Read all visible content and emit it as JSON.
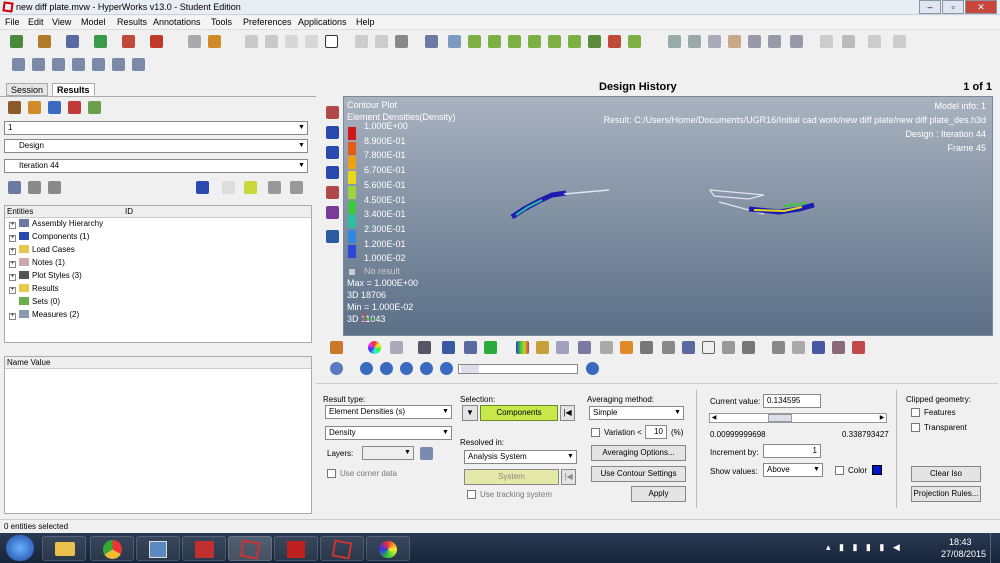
{
  "window": {
    "title": "new diff plate.mvw - HyperWorks v13.0 - Student Edition"
  },
  "menu": [
    "File",
    "Edit",
    "View",
    "Model",
    "Results",
    "Annotations",
    "Tools",
    "Preferences",
    "Applications",
    "Help"
  ],
  "left_panel": {
    "tabs": [
      "Session",
      "Results"
    ],
    "active_tab": "Results",
    "dropdown1": "1",
    "dropdown2": "Design",
    "dropdown3": "Iteration 44",
    "entities_header": "Entities",
    "entities_cols": "ID",
    "tree": [
      "Assembly Hierarchy",
      "Components (1)",
      "Load Cases",
      "Notes (1)",
      "Plot Styles (3)",
      "Results",
      "Sets  (0)",
      "Measures (2)"
    ],
    "props_header": "Name Value"
  },
  "page": {
    "title": "Design History",
    "page_count": "1 of 1"
  },
  "viewport": {
    "plot_title": "Contour Plot",
    "plot_sub": "Element Densities(Density)",
    "legend_values": [
      "1.000E+00",
      "8.900E-01",
      "7.800E-01",
      "6.700E-01",
      "5.600E-01",
      "4.500E-01",
      "3.400E-01",
      "2.300E-01",
      "1.200E-01",
      "1.000E-02"
    ],
    "legend_colors": [
      "#d0181c",
      "#e65c14",
      "#f0a014",
      "#e8d81c",
      "#9cd43c",
      "#3cc83c",
      "#2cc0a0",
      "#2c88e0",
      "#2c48d8",
      "#1c1cb0"
    ],
    "no_result": "No result",
    "max_text": "Max = 1.000E+00",
    "max_loc": "3D 18706",
    "min_text": "Min = 1.000E-02",
    "min_loc": "3D 11043",
    "model_info": "Model info: 1",
    "result_path": "Result: C:/Users/Home/Documents/UGR16/Initial cad work/new diff plate/new diff plate_des.h3d",
    "design_text": "Design : Iteration 44",
    "frame_text": "Frame 45"
  },
  "controls": {
    "result_type_label": "Result type:",
    "result_type": "Element Densities (s)",
    "result_sub": "Density",
    "layers_label": "Layers:",
    "use_corner": "Use corner data",
    "selection_label": "Selection:",
    "selection_value": "Components",
    "resolved_label": "Resolved in:",
    "resolved_value": "Analysis System",
    "system_button": "System",
    "use_tracking": "Use tracking system",
    "averaging_label": "Averaging method:",
    "averaging_value": "Simple",
    "variation_label": "Variation <",
    "variation_value": "10",
    "variation_unit": "(%)",
    "averaging_options": "Averaging Options...",
    "contour_settings": "Use Contour Settings",
    "apply": "Apply",
    "current_value_label": "Current value:",
    "current_value": "0.134595",
    "slider_position": 0.36,
    "range_min": "0.00999999698",
    "range_max": "0.338793427",
    "increment_label": "Increment by:",
    "increment_value": "1",
    "show_values_label": "Show values:",
    "show_values": "Above",
    "color_label": "Color",
    "color_swatch": "#0014c8",
    "clipped_label": "Clipped geometry:",
    "features": "Features",
    "transparent": "Transparent",
    "clear_iso": "Clear Iso",
    "projection_rules": "Projection Rules..."
  },
  "status": "0 entities selected",
  "clock": {
    "time": "18:43",
    "date": "27/08/2015"
  }
}
